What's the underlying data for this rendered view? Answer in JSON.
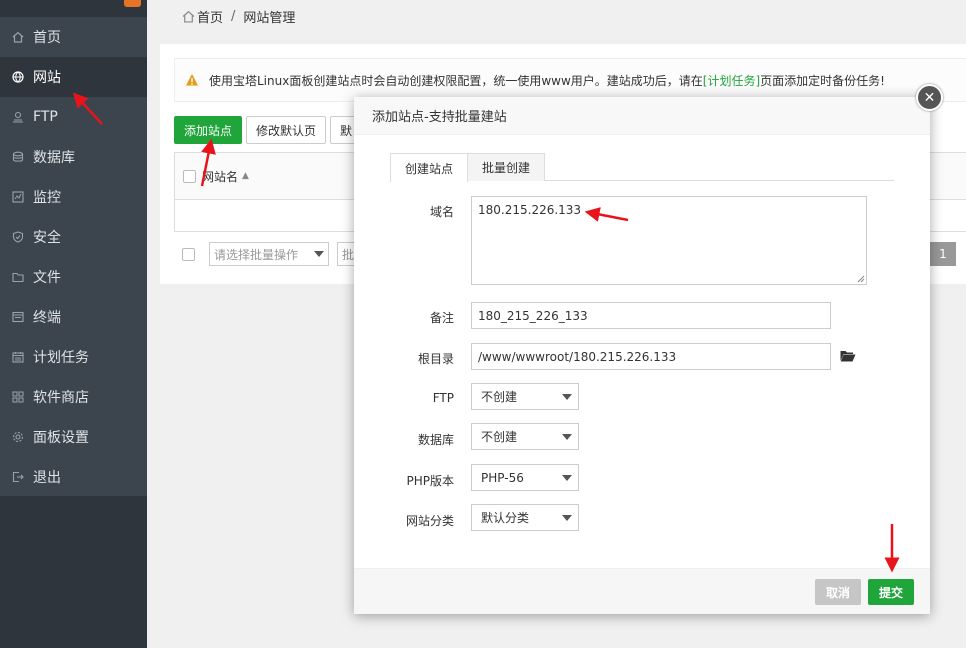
{
  "sidebar": {
    "items": [
      {
        "label": "首页",
        "icon": "home-icon"
      },
      {
        "label": "网站",
        "icon": "globe-icon",
        "active": true
      },
      {
        "label": "FTP",
        "icon": "ftp-icon"
      },
      {
        "label": "数据库",
        "icon": "database-icon"
      },
      {
        "label": "监控",
        "icon": "monitor-icon"
      },
      {
        "label": "安全",
        "icon": "shield-icon"
      },
      {
        "label": "文件",
        "icon": "folder-icon"
      },
      {
        "label": "终端",
        "icon": "terminal-icon"
      },
      {
        "label": "计划任务",
        "icon": "calendar-icon"
      },
      {
        "label": "软件商店",
        "icon": "apps-icon"
      },
      {
        "label": "面板设置",
        "icon": "gear-icon"
      },
      {
        "label": "退出",
        "icon": "logout-icon"
      }
    ]
  },
  "breadcrumb": {
    "home": "首页",
    "separator": "/",
    "current": "网站管理"
  },
  "notice": {
    "text_before": "使用宝塔Linux面板创建站点时会自动创建权限配置，统一使用www用户。建站成功后，请在",
    "link": "[计划任务]",
    "text_after": "页面添加定时备份任务!"
  },
  "toolbar": {
    "add_site": "添加站点",
    "edit_default": "修改默认页",
    "default_site": "默"
  },
  "table": {
    "header_site_name": "网站名",
    "sort_glyph": "▲",
    "batch_select_placeholder": "请选择批量操作",
    "batch_button": "批",
    "page_number": "1"
  },
  "modal": {
    "title": "添加站点-支持批量建站",
    "close_glyph": "✕",
    "tabs": [
      "创建站点",
      "批量创建"
    ],
    "fields": {
      "domain_label": "域名",
      "domain_value": "180.215.226.133",
      "remark_label": "备注",
      "remark_value": "180_215_226_133",
      "root_label": "根目录",
      "root_value": "/www/wwwroot/180.215.226.133",
      "ftp_label": "FTP",
      "ftp_value": "不创建",
      "db_label": "数据库",
      "db_value": "不创建",
      "php_label": "PHP版本",
      "php_value": "PHP-56",
      "category_label": "网站分类",
      "category_value": "默认分类"
    },
    "buttons": {
      "cancel": "取消",
      "submit": "提交"
    }
  },
  "colors": {
    "sidebar_bg": "#3c444d",
    "accent_green": "#20a53a",
    "annotation_red": "#e8141c",
    "warning_orange": "#e59b1a"
  }
}
